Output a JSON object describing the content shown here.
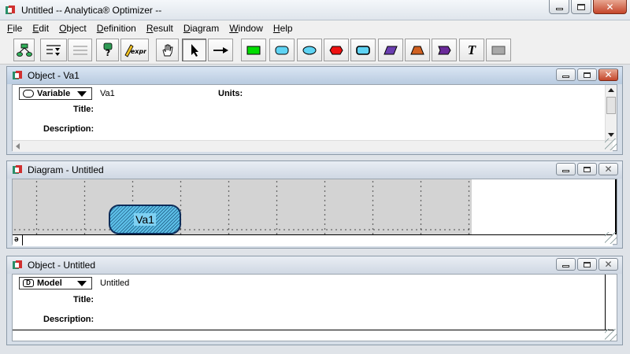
{
  "window": {
    "title": "Untitled -- Analytica® Optimizer --"
  },
  "menu": [
    "File",
    "Edit",
    "Object",
    "Definition",
    "Result",
    "Diagram",
    "Window",
    "Help"
  ],
  "menu_underline": [
    "F",
    "E",
    "O",
    "D",
    "R",
    "D",
    "W",
    "H"
  ],
  "toolbar": {
    "items": [
      "diagram-view-icon",
      "outline-view-icon",
      "outline-collapse-icon",
      "find-icon",
      "edit-expression-icon",
      "browse-hand-icon",
      "arrow-pointer-icon",
      "arrow-connect-icon",
      "decision-node-icon",
      "variable-node-icon",
      "chance-node-icon",
      "objective-node-icon",
      "module-node-icon",
      "constant-node-icon",
      "index-node-icon",
      "function-node-icon",
      "text-node-icon",
      "library-node-icon"
    ],
    "expr_label": "expr",
    "text_tool_label": "T"
  },
  "colors": {
    "decision": "#00dd00",
    "variable": "#5fd3f3",
    "chance": "#5fd3f3",
    "objective": "#ee1111",
    "module": "#5fd3f3",
    "constant": "#6a3eb0",
    "index": "#d06020",
    "function": "#6a2a9a",
    "library": "#a8a8a8",
    "node_fill": "#5fc2ea"
  },
  "object_var": {
    "title": "Object - Va1",
    "type": "Variable",
    "identifier": "Va1",
    "units_label": "Units:",
    "title_label": "Title:",
    "description_label": "Description:"
  },
  "diagram": {
    "title": "Diagram - Untitled",
    "node_label": "Va1",
    "status_glyph": "ə"
  },
  "object_model": {
    "title": "Object - Untitled",
    "type": "Model",
    "type_glyph": "D",
    "identifier": "Untitled",
    "title_label": "Title:",
    "description_label": "Description:"
  }
}
